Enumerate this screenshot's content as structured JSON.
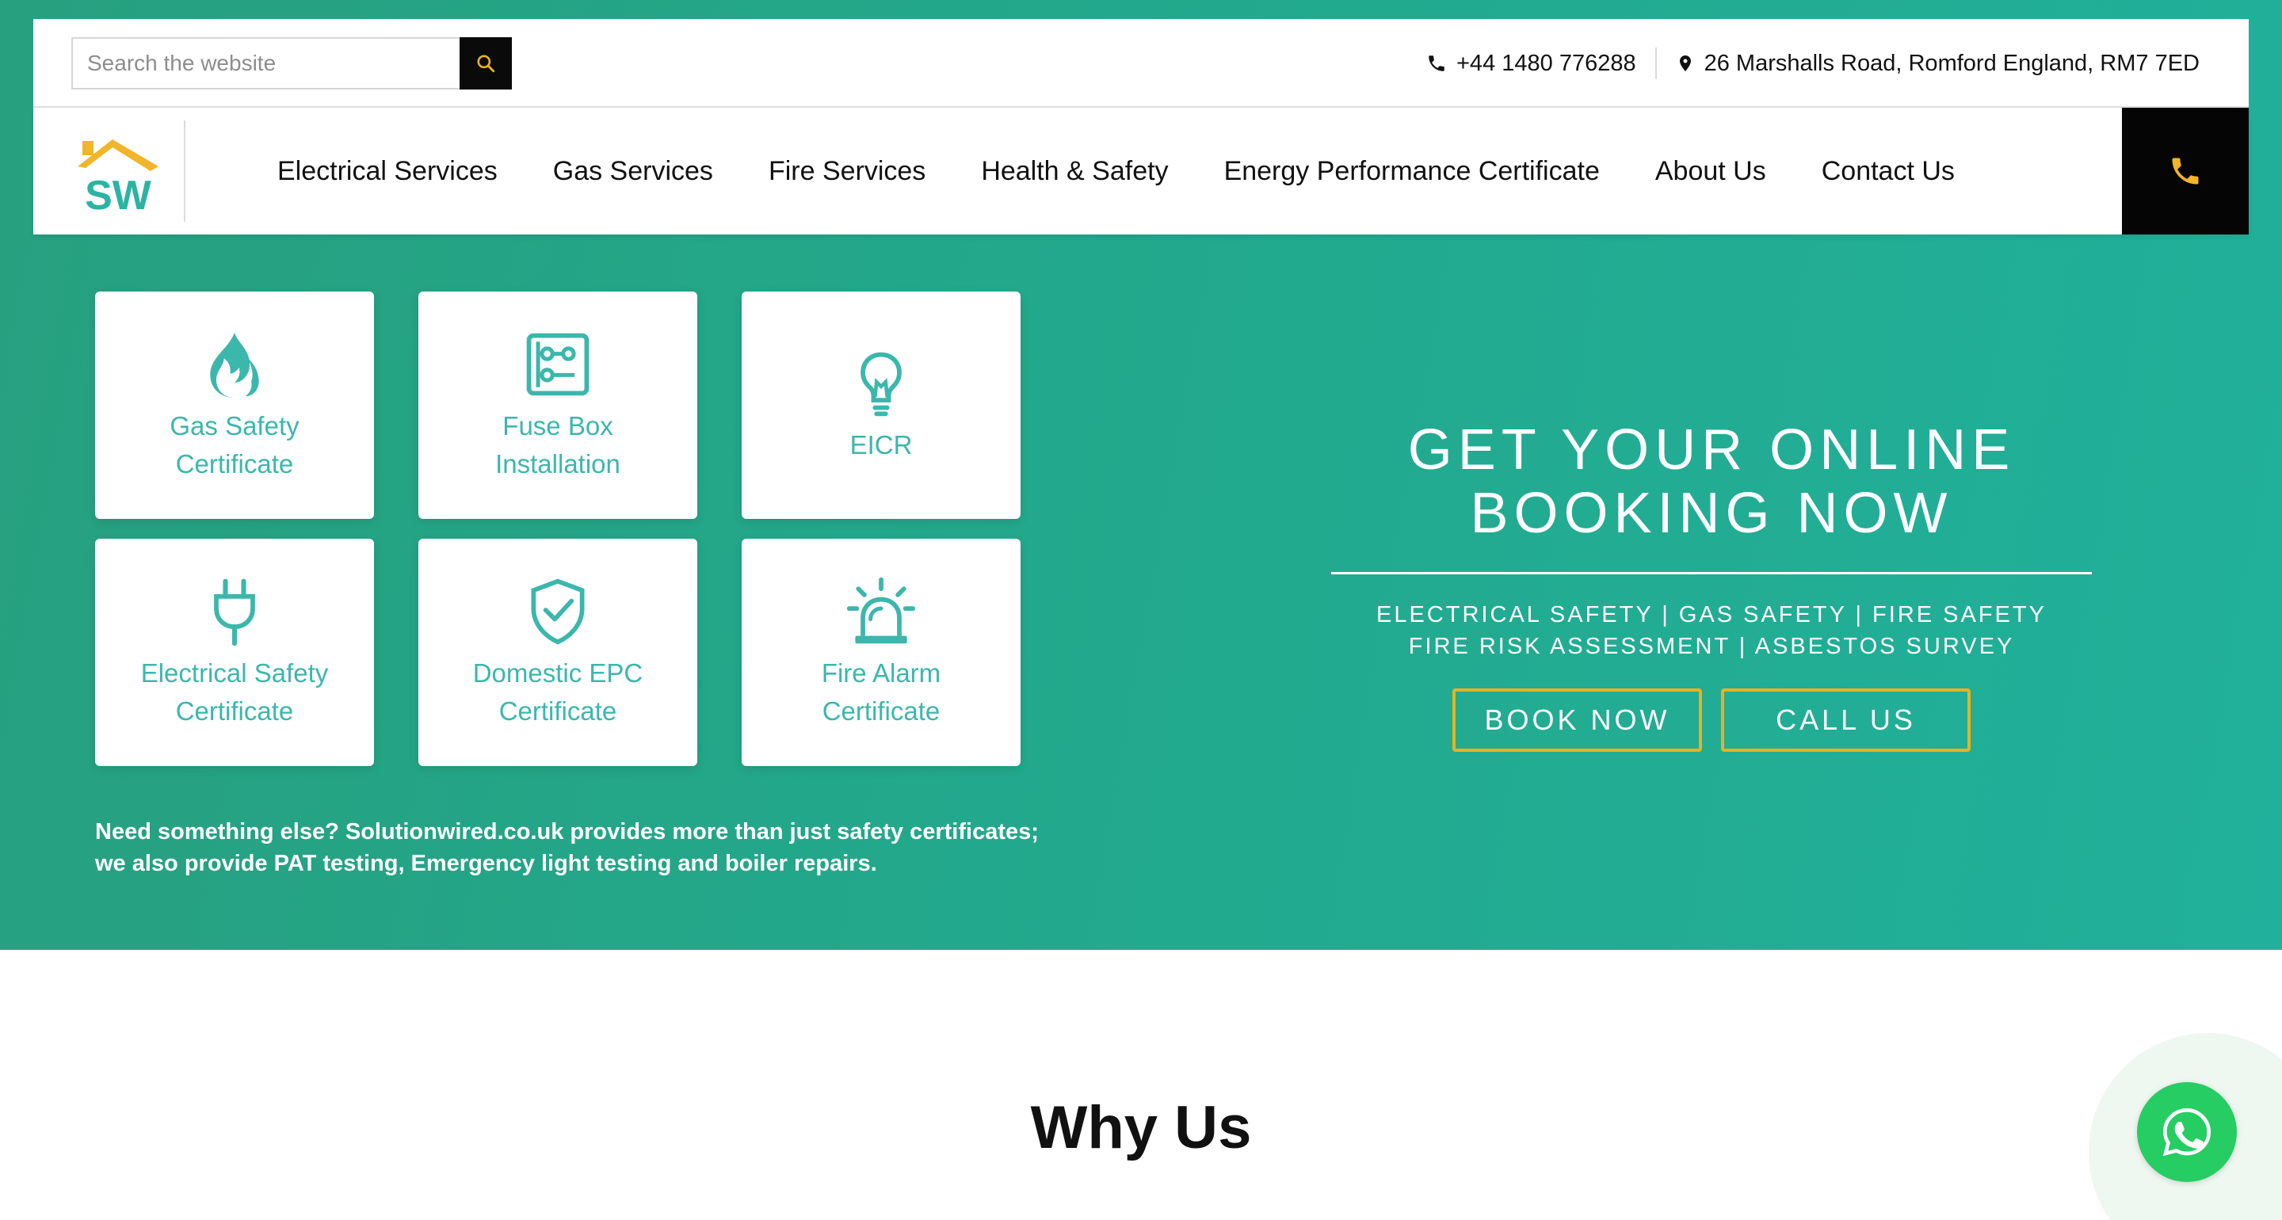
{
  "topbar": {
    "search_placeholder": "Search the website",
    "phone": "+44 1480 776288",
    "address": "26 Marshalls Road, Romford England, RM7 7ED"
  },
  "logo": {
    "text": "SW"
  },
  "nav": {
    "items": [
      "Electrical Services",
      "Gas Services",
      "Fire Services",
      "Health & Safety",
      "Energy Performance Certificate",
      "About Us",
      "Contact Us"
    ]
  },
  "cards": [
    {
      "label": "Gas Safety\nCertificate",
      "icon": "flame-icon"
    },
    {
      "label": "Fuse Box\nInstallation",
      "icon": "fuse-box-icon"
    },
    {
      "label": "EICR",
      "icon": "lightbulb-icon"
    },
    {
      "label": "Electrical Safety\nCertificate",
      "icon": "plug-icon"
    },
    {
      "label": "Domestic EPC\nCertificate",
      "icon": "shield-check-icon"
    },
    {
      "label": "Fire Alarm\nCertificate",
      "icon": "alarm-icon"
    }
  ],
  "note": "Need something else? Solutionwired.co.uk provides more than just safety certificates; we also provide PAT testing, Emergency light testing and boiler repairs.",
  "booking": {
    "title_line1": "GET YOUR ONLINE",
    "title_line2": "BOOKING NOW",
    "subtitle": "ELECTRICAL SAFETY | GAS SAFETY | FIRE SAFETY FIRE RISK ASSESSMENT | ASBESTOS SURVEY",
    "book_label": "BOOK NOW",
    "call_label": "CALL US"
  },
  "why": {
    "title": "Why Us"
  },
  "colors": {
    "accent": "#3bb7ac",
    "gold": "#eab21f",
    "hero_start": "#27a07f",
    "hero_end": "#21b09b",
    "whatsapp": "#25cd63"
  }
}
